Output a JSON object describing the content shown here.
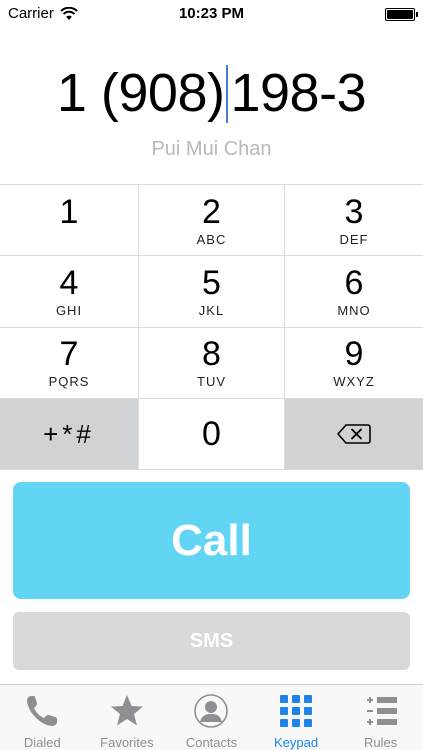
{
  "status": {
    "carrier": "Carrier",
    "time": "10:23 PM"
  },
  "dialer": {
    "number_before_cursor": "1 (908)",
    "number_after_cursor": "198-3",
    "contact_name": "Pui Mui Chan"
  },
  "keypad": {
    "keys": [
      {
        "digit": "1",
        "letters": ""
      },
      {
        "digit": "2",
        "letters": "ABC"
      },
      {
        "digit": "3",
        "letters": "DEF"
      },
      {
        "digit": "4",
        "letters": "GHI"
      },
      {
        "digit": "5",
        "letters": "JKL"
      },
      {
        "digit": "6",
        "letters": "MNO"
      },
      {
        "digit": "7",
        "letters": "PQRS"
      },
      {
        "digit": "8",
        "letters": "TUV"
      },
      {
        "digit": "9",
        "letters": "WXYZ"
      }
    ],
    "special": "+*#",
    "zero": "0"
  },
  "actions": {
    "call_label": "Call",
    "sms_label": "SMS"
  },
  "tabs": [
    {
      "label": "Dialed",
      "icon": "phone-icon"
    },
    {
      "label": "Favorites",
      "icon": "star-icon"
    },
    {
      "label": "Contacts",
      "icon": "person-icon"
    },
    {
      "label": "Keypad",
      "icon": "keypad-icon"
    },
    {
      "label": "Rules",
      "icon": "rules-icon"
    }
  ],
  "colors": {
    "accent": "#1f84e6",
    "call_button": "#62d5f5",
    "sms_button": "#d9d9d9",
    "cursor": "#4a7fd0"
  }
}
